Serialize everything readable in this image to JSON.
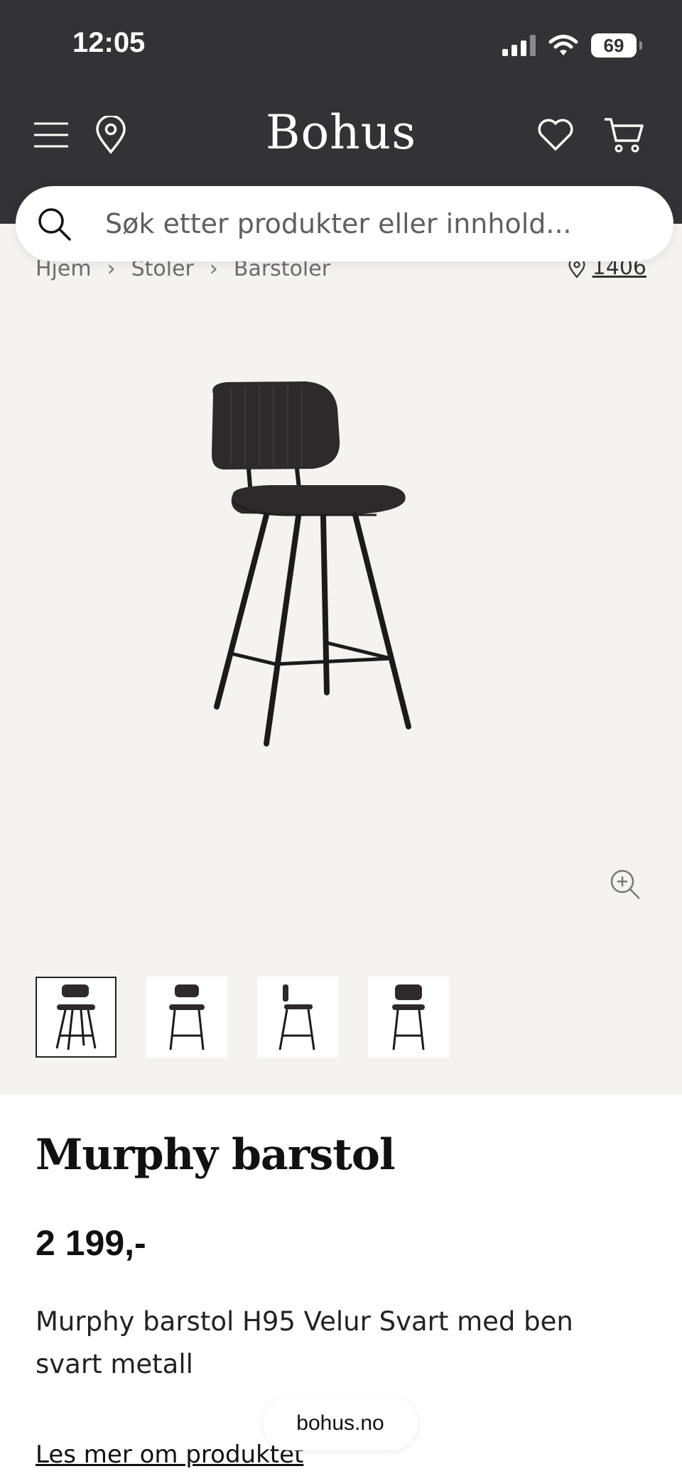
{
  "status_bar": {
    "time": "12:05",
    "battery": "69"
  },
  "header": {
    "logo": "Bohus",
    "icons": [
      "menu-icon",
      "location-pin-icon",
      "heart-icon",
      "cart-icon"
    ]
  },
  "search": {
    "placeholder": "Søk etter produkter eller innhold..."
  },
  "breadcrumb": {
    "items": [
      "Hjem",
      "Stoler",
      "Barstoler"
    ],
    "store": "1406"
  },
  "gallery": {
    "thumbnail_count": 4,
    "active_thumbnail": 1
  },
  "product": {
    "title": "Murphy barstol",
    "price": "2 199,-",
    "description": "Murphy barstol H95 Velur Svart med ben svart metall",
    "more_link": "Les mer om produktet"
  },
  "browser": {
    "url": "bohus.no"
  },
  "colors": {
    "header_bg": "#333236",
    "gallery_bg": "#f5f3f2",
    "text": "#111111"
  }
}
